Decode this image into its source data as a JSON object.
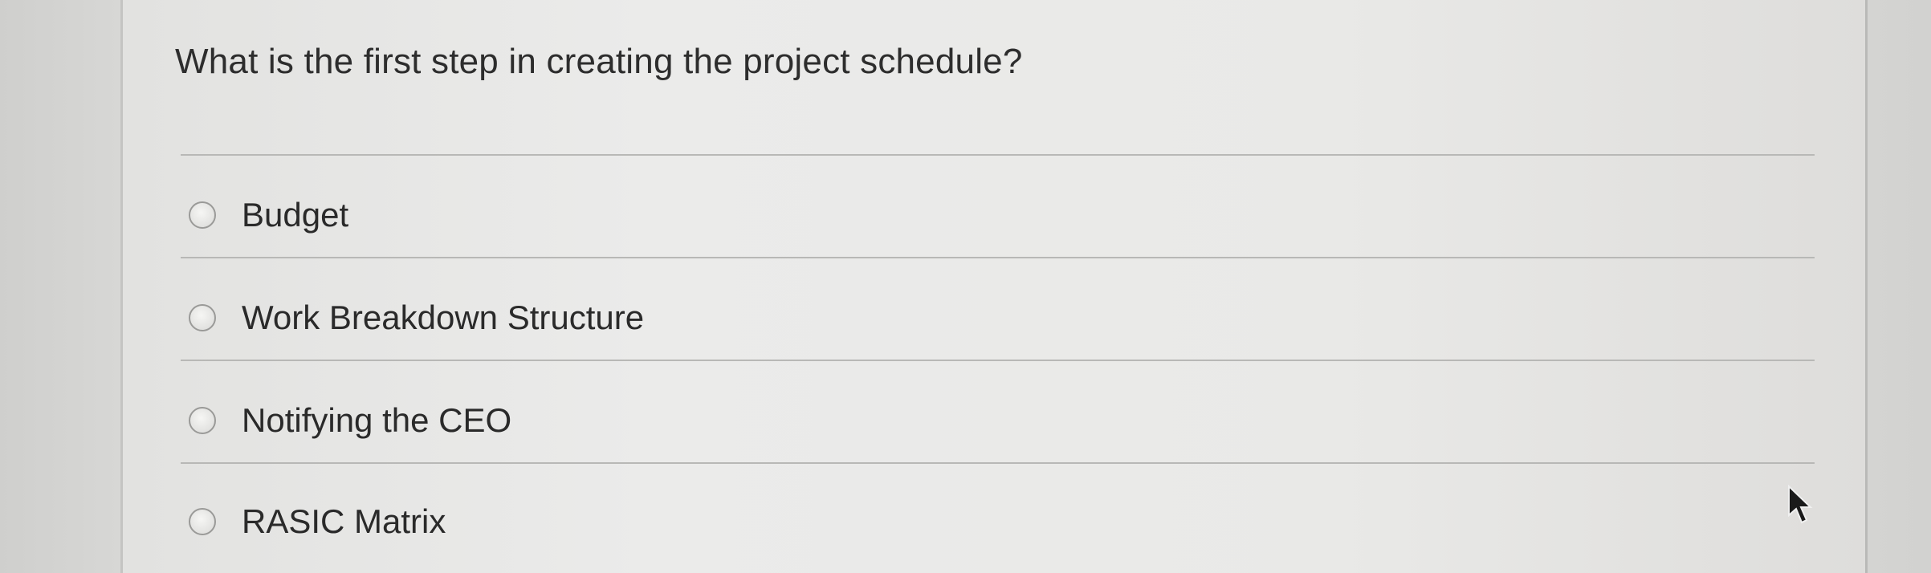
{
  "question": {
    "text": "What is the first step in creating the project schedule?"
  },
  "options": [
    {
      "label": "Budget",
      "selected": false
    },
    {
      "label": "Work Breakdown Structure",
      "selected": false
    },
    {
      "label": "Notifying the CEO",
      "selected": false
    },
    {
      "label": "RASIC Matrix",
      "selected": false
    }
  ],
  "icons": {
    "cursor": "mouse-pointer-icon",
    "radio": "radio-button-icon"
  },
  "colors": {
    "text": "#2a2a2a",
    "rule": "#b8b8b6",
    "background": "#e6e6e4"
  }
}
